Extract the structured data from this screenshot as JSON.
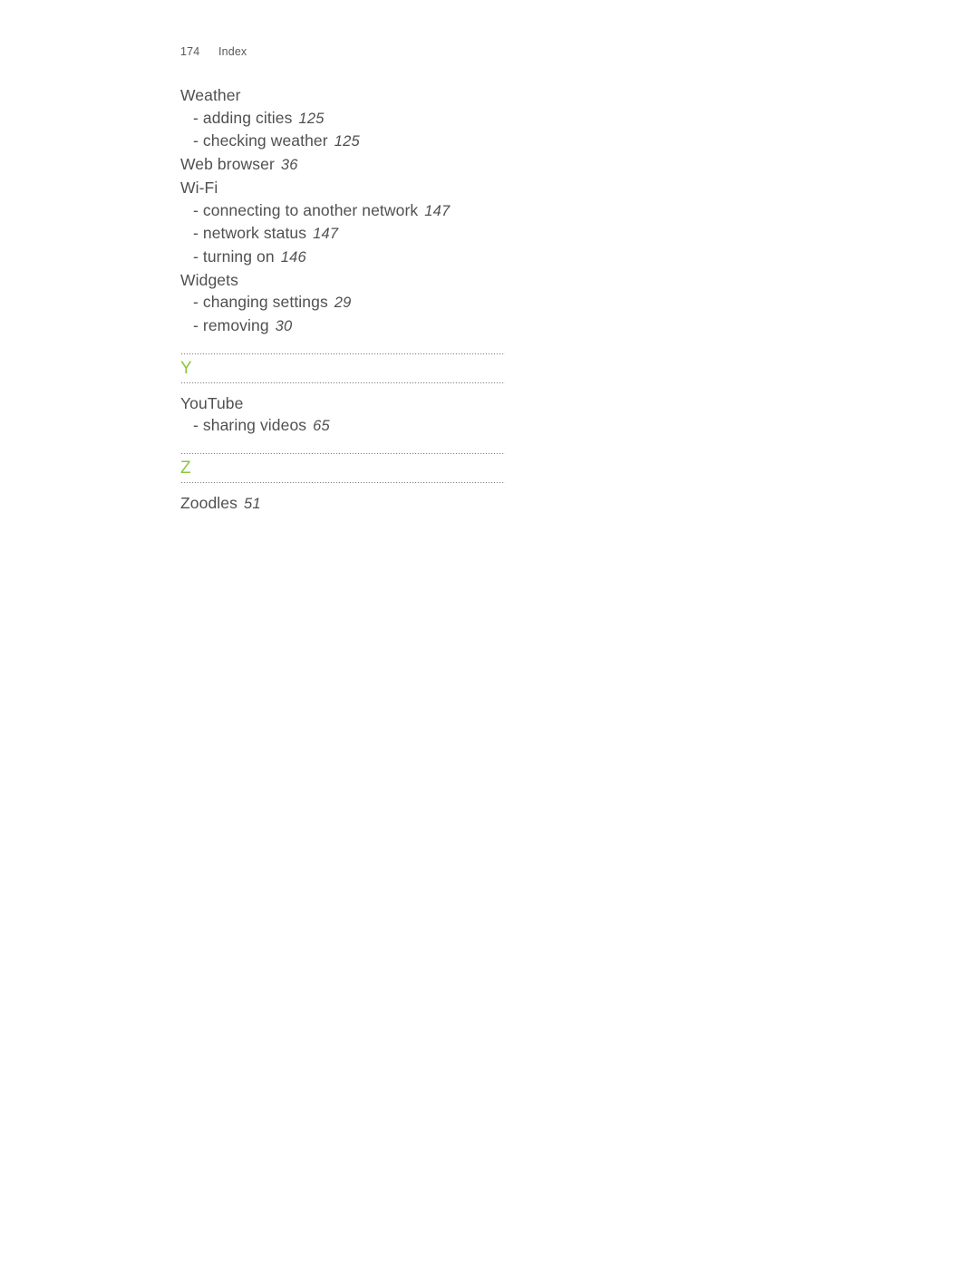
{
  "document": {
    "background_color": "#ffffff",
    "text_color": "#4f5052",
    "accent_color": "#8cc63f",
    "rule_color": "#808285"
  },
  "header": {
    "folio": "174",
    "section_name": "Index"
  },
  "index": {
    "leading_entries": [
      {
        "label": "Weather",
        "page": "",
        "level": 0
      },
      {
        "label": "- adding cities",
        "page": "125",
        "level": 1
      },
      {
        "label": "- checking weather",
        "page": "125",
        "level": 1
      },
      {
        "label": "Web browser",
        "page": "36",
        "level": 0
      },
      {
        "label": "Wi-Fi",
        "page": "",
        "level": 0
      },
      {
        "label": "- connecting to another network",
        "page": "147",
        "level": 1
      },
      {
        "label": "- network status",
        "page": "147",
        "level": 1
      },
      {
        "label": "- turning on",
        "page": "146",
        "level": 1
      },
      {
        "label": "Widgets",
        "page": "",
        "level": 0
      },
      {
        "label": "- changing settings",
        "page": "29",
        "level": 1
      },
      {
        "label": "- removing",
        "page": "30",
        "level": 1
      }
    ],
    "groups": [
      {
        "letter": "Y",
        "entries": [
          {
            "label": "YouTube",
            "page": "",
            "level": 0
          },
          {
            "label": "- sharing videos",
            "page": "65",
            "level": 1
          }
        ]
      },
      {
        "letter": "Z",
        "entries": [
          {
            "label": "Zoodles",
            "page": "51",
            "level": 0
          }
        ]
      }
    ]
  }
}
